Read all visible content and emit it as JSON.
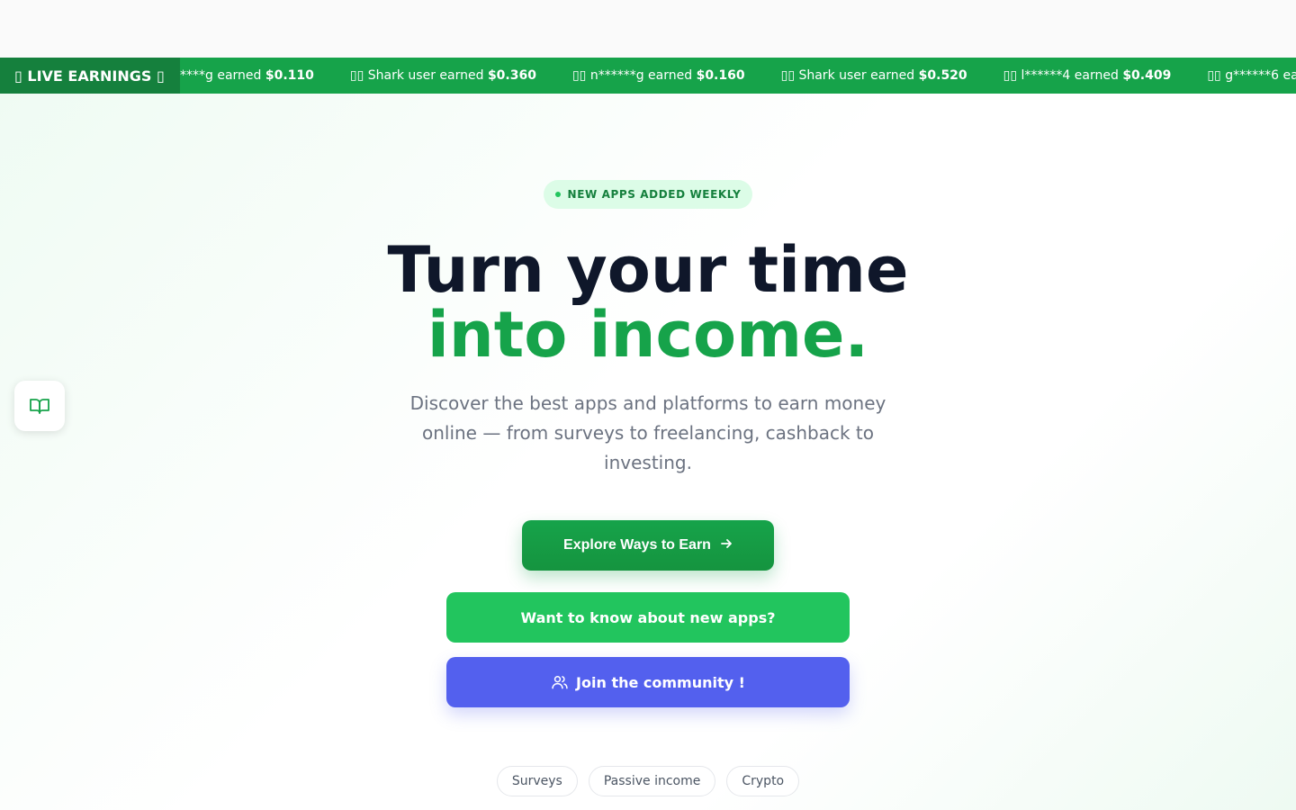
{
  "ticker": {
    "label": "▯ LIVE EARNINGS ▯",
    "items": [
      {
        "user": "****g",
        "text": "earned",
        "amount": "$0.110"
      },
      {
        "user": "▯▯ Shark user",
        "text": "earned",
        "amount": "$0.360"
      },
      {
        "user": "▯▯ n******g",
        "text": "earned",
        "amount": "$0.160"
      },
      {
        "user": "▯▯ Shark user",
        "text": "earned",
        "amount": "$0.520"
      },
      {
        "user": "▯▯ l******4",
        "text": "earned",
        "amount": "$0.409"
      },
      {
        "user": "▯▯ g******6",
        "text": "earned",
        "amount": ""
      }
    ]
  },
  "hero": {
    "badge": "NEW APPS ADDED WEEKLY",
    "title_line1": "Turn your time",
    "title_line2": "into income.",
    "subtitle": "Discover the best apps and platforms to earn money online — from surveys to freelancing, cashback to investing.",
    "explore_button": "Explore Ways to Earn",
    "new_apps_button": "Want to know about new apps?",
    "community_button": "Join the community !",
    "chips": [
      "Surveys",
      "Passive income",
      "Crypto"
    ]
  },
  "colors": {
    "accent": "#16a34a",
    "ticker_bg": "#16a34a",
    "community": "#5360ee",
    "title_dark": "#0f172a"
  },
  "icons": {
    "side": "book-open-icon",
    "community": "users-icon",
    "explore": "arrow-right-icon"
  }
}
